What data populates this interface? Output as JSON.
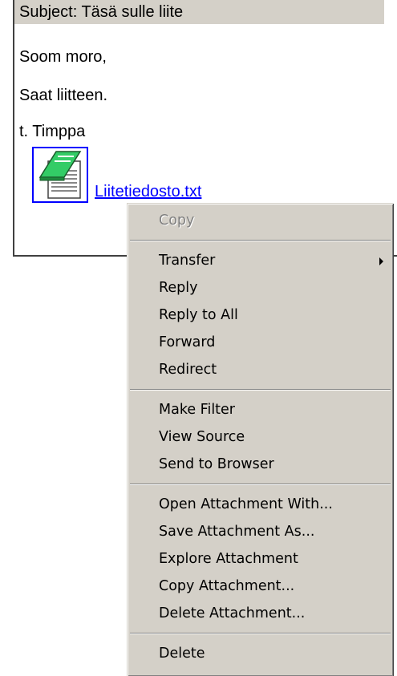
{
  "message": {
    "subject": "Subject: Täsä sulle liite",
    "greeting": "Soom moro,",
    "body": "Saat liitteen.",
    "signature": "t. Timppa",
    "attachment": {
      "icon": "notepad-text-file-icon",
      "filename": "Liitetiedosto.txt"
    }
  },
  "context_menu": {
    "groups": [
      [
        {
          "label": "Copy",
          "enabled": false
        }
      ],
      [
        {
          "label": "Transfer",
          "submenu": true
        },
        {
          "label": "Reply"
        },
        {
          "label": "Reply to All"
        },
        {
          "label": "Forward"
        },
        {
          "label": "Redirect"
        }
      ],
      [
        {
          "label": "Make Filter"
        },
        {
          "label": "View Source"
        },
        {
          "label": "Send to Browser"
        }
      ],
      [
        {
          "label": "Open Attachment With..."
        },
        {
          "label": "Save Attachment As..."
        },
        {
          "label": "Explore Attachment"
        },
        {
          "label": "Copy Attachment..."
        },
        {
          "label": "Delete Attachment..."
        }
      ],
      [
        {
          "label": "Delete"
        }
      ]
    ]
  },
  "colors": {
    "menu_bg": "#d4d0c8",
    "link": "#0000ff",
    "disabled_text": "#808080"
  }
}
